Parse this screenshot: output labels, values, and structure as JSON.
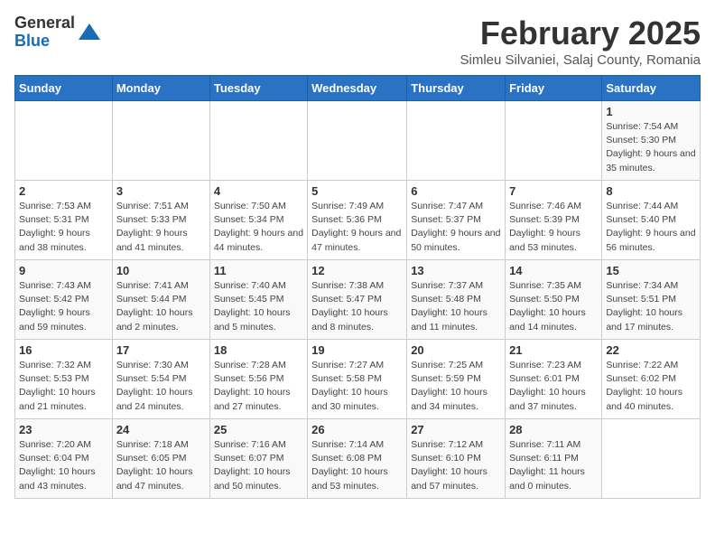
{
  "logo": {
    "general": "General",
    "blue": "Blue"
  },
  "title": "February 2025",
  "subtitle": "Simleu Silvaniei, Salaj County, Romania",
  "days_of_week": [
    "Sunday",
    "Monday",
    "Tuesday",
    "Wednesday",
    "Thursday",
    "Friday",
    "Saturday"
  ],
  "weeks": [
    [
      {
        "day": "",
        "info": ""
      },
      {
        "day": "",
        "info": ""
      },
      {
        "day": "",
        "info": ""
      },
      {
        "day": "",
        "info": ""
      },
      {
        "day": "",
        "info": ""
      },
      {
        "day": "",
        "info": ""
      },
      {
        "day": "1",
        "info": "Sunrise: 7:54 AM\nSunset: 5:30 PM\nDaylight: 9 hours and 35 minutes."
      }
    ],
    [
      {
        "day": "2",
        "info": "Sunrise: 7:53 AM\nSunset: 5:31 PM\nDaylight: 9 hours and 38 minutes."
      },
      {
        "day": "3",
        "info": "Sunrise: 7:51 AM\nSunset: 5:33 PM\nDaylight: 9 hours and 41 minutes."
      },
      {
        "day": "4",
        "info": "Sunrise: 7:50 AM\nSunset: 5:34 PM\nDaylight: 9 hours and 44 minutes."
      },
      {
        "day": "5",
        "info": "Sunrise: 7:49 AM\nSunset: 5:36 PM\nDaylight: 9 hours and 47 minutes."
      },
      {
        "day": "6",
        "info": "Sunrise: 7:47 AM\nSunset: 5:37 PM\nDaylight: 9 hours and 50 minutes."
      },
      {
        "day": "7",
        "info": "Sunrise: 7:46 AM\nSunset: 5:39 PM\nDaylight: 9 hours and 53 minutes."
      },
      {
        "day": "8",
        "info": "Sunrise: 7:44 AM\nSunset: 5:40 PM\nDaylight: 9 hours and 56 minutes."
      }
    ],
    [
      {
        "day": "9",
        "info": "Sunrise: 7:43 AM\nSunset: 5:42 PM\nDaylight: 9 hours and 59 minutes."
      },
      {
        "day": "10",
        "info": "Sunrise: 7:41 AM\nSunset: 5:44 PM\nDaylight: 10 hours and 2 minutes."
      },
      {
        "day": "11",
        "info": "Sunrise: 7:40 AM\nSunset: 5:45 PM\nDaylight: 10 hours and 5 minutes."
      },
      {
        "day": "12",
        "info": "Sunrise: 7:38 AM\nSunset: 5:47 PM\nDaylight: 10 hours and 8 minutes."
      },
      {
        "day": "13",
        "info": "Sunrise: 7:37 AM\nSunset: 5:48 PM\nDaylight: 10 hours and 11 minutes."
      },
      {
        "day": "14",
        "info": "Sunrise: 7:35 AM\nSunset: 5:50 PM\nDaylight: 10 hours and 14 minutes."
      },
      {
        "day": "15",
        "info": "Sunrise: 7:34 AM\nSunset: 5:51 PM\nDaylight: 10 hours and 17 minutes."
      }
    ],
    [
      {
        "day": "16",
        "info": "Sunrise: 7:32 AM\nSunset: 5:53 PM\nDaylight: 10 hours and 21 minutes."
      },
      {
        "day": "17",
        "info": "Sunrise: 7:30 AM\nSunset: 5:54 PM\nDaylight: 10 hours and 24 minutes."
      },
      {
        "day": "18",
        "info": "Sunrise: 7:28 AM\nSunset: 5:56 PM\nDaylight: 10 hours and 27 minutes."
      },
      {
        "day": "19",
        "info": "Sunrise: 7:27 AM\nSunset: 5:58 PM\nDaylight: 10 hours and 30 minutes."
      },
      {
        "day": "20",
        "info": "Sunrise: 7:25 AM\nSunset: 5:59 PM\nDaylight: 10 hours and 34 minutes."
      },
      {
        "day": "21",
        "info": "Sunrise: 7:23 AM\nSunset: 6:01 PM\nDaylight: 10 hours and 37 minutes."
      },
      {
        "day": "22",
        "info": "Sunrise: 7:22 AM\nSunset: 6:02 PM\nDaylight: 10 hours and 40 minutes."
      }
    ],
    [
      {
        "day": "23",
        "info": "Sunrise: 7:20 AM\nSunset: 6:04 PM\nDaylight: 10 hours and 43 minutes."
      },
      {
        "day": "24",
        "info": "Sunrise: 7:18 AM\nSunset: 6:05 PM\nDaylight: 10 hours and 47 minutes."
      },
      {
        "day": "25",
        "info": "Sunrise: 7:16 AM\nSunset: 6:07 PM\nDaylight: 10 hours and 50 minutes."
      },
      {
        "day": "26",
        "info": "Sunrise: 7:14 AM\nSunset: 6:08 PM\nDaylight: 10 hours and 53 minutes."
      },
      {
        "day": "27",
        "info": "Sunrise: 7:12 AM\nSunset: 6:10 PM\nDaylight: 10 hours and 57 minutes."
      },
      {
        "day": "28",
        "info": "Sunrise: 7:11 AM\nSunset: 6:11 PM\nDaylight: 11 hours and 0 minutes."
      },
      {
        "day": "",
        "info": ""
      }
    ]
  ]
}
